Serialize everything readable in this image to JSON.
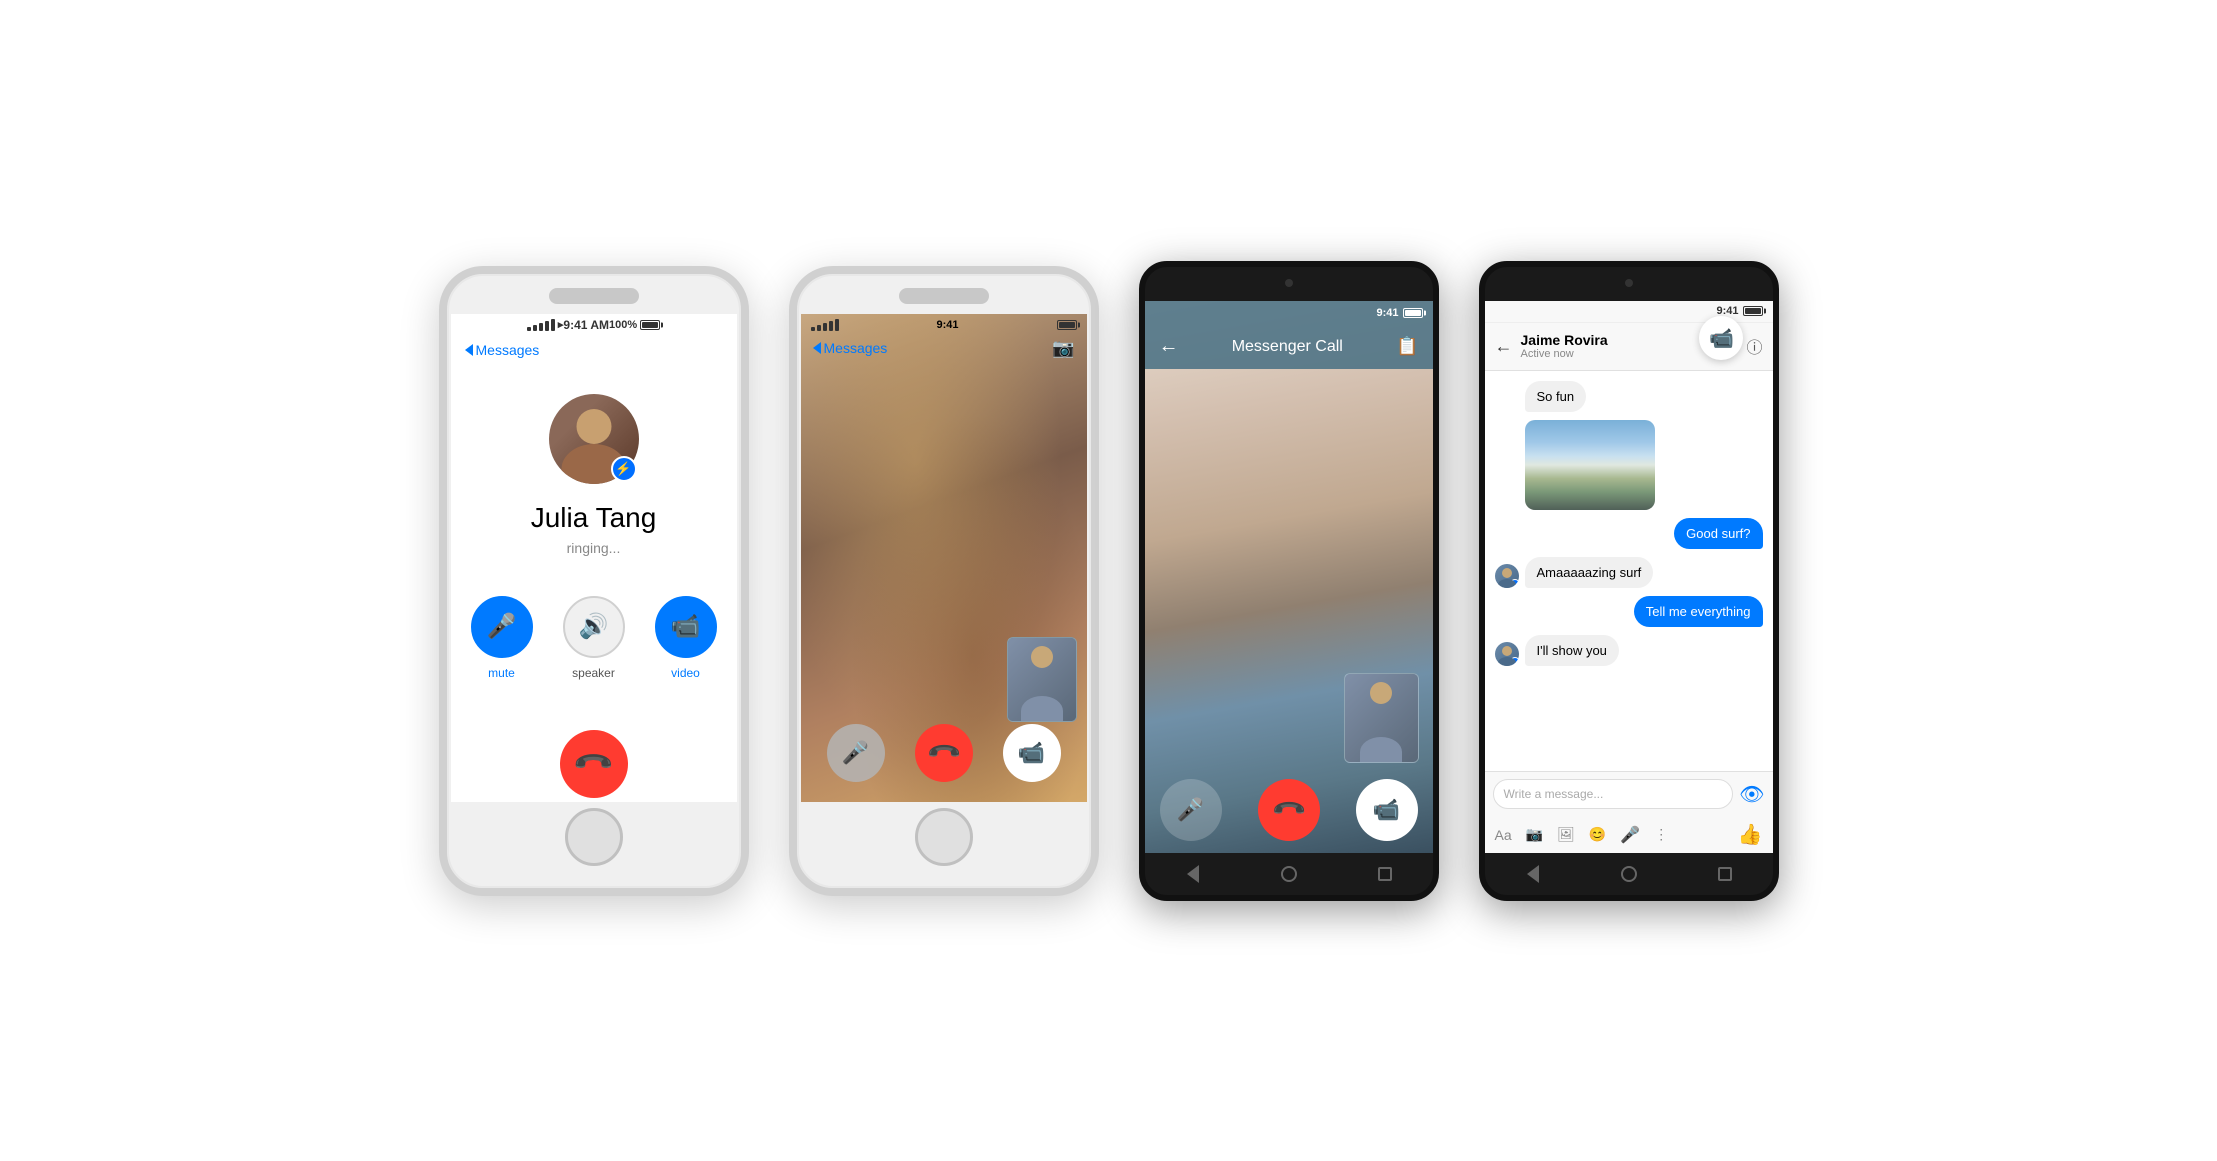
{
  "background": "#ffffff",
  "phones": [
    {
      "id": "phone1",
      "type": "iphone",
      "description": "iPhone calling screen",
      "status_bar": {
        "left": "●●●●● ▸",
        "center": "9:41 AM",
        "right": "100%"
      },
      "nav": {
        "back_label": "Messages"
      },
      "contact": {
        "name": "Julia Tang",
        "status": "ringing..."
      },
      "controls": [
        {
          "id": "mute",
          "label": "mute",
          "icon": "🎤",
          "style": "blue"
        },
        {
          "id": "speaker",
          "label": "speaker",
          "icon": "🔊",
          "style": "white"
        },
        {
          "id": "video",
          "label": "video",
          "icon": "📷",
          "style": "blue"
        }
      ],
      "end_call_icon": "📞"
    },
    {
      "id": "phone2",
      "type": "iphone",
      "description": "iPhone video call screen",
      "status_bar": {
        "left": "●●●●● ▸",
        "center": "9:41",
        "right": "100%"
      },
      "nav": {
        "back_label": "Messages"
      },
      "pip": true,
      "controls": [
        {
          "id": "mute",
          "icon": "🎤",
          "style": "mute"
        },
        {
          "id": "end",
          "icon": "📞",
          "style": "end"
        },
        {
          "id": "video",
          "icon": "📷",
          "style": "video"
        }
      ]
    },
    {
      "id": "phone3",
      "type": "android",
      "description": "Android video call screen",
      "status_bar": {
        "right": "9:41"
      },
      "header": {
        "title": "Messenger Call",
        "back_icon": "←",
        "right_icon": "📋"
      },
      "pip": true,
      "controls": [
        {
          "id": "mute",
          "icon": "🎤",
          "style": "mute"
        },
        {
          "id": "end",
          "icon": "📞",
          "style": "end"
        },
        {
          "id": "video",
          "icon": "📷",
          "style": "video"
        }
      ]
    },
    {
      "id": "phone4",
      "type": "android",
      "description": "Android chat screen",
      "status_bar": {
        "right": "9:41"
      },
      "header": {
        "contact_name": "Jaime Rovira",
        "contact_status": "Active now",
        "back_icon": "←",
        "video_icon": "📹",
        "info_icon": "ⓘ"
      },
      "messages": [
        {
          "id": "m1",
          "type": "recv",
          "text": "So fun",
          "has_avatar": false
        },
        {
          "id": "m2",
          "type": "recv",
          "text": "image",
          "has_image": true,
          "has_avatar": false
        },
        {
          "id": "m3",
          "type": "sent",
          "text": "Good surf?"
        },
        {
          "id": "m4",
          "type": "recv",
          "text": "Amaaaaazing surf",
          "has_avatar": true
        },
        {
          "id": "m5",
          "type": "sent",
          "text": "Tell me everything"
        },
        {
          "id": "m6",
          "type": "recv",
          "text": "I'll show you",
          "has_avatar": true
        }
      ],
      "input_placeholder": "Write a message...",
      "action_icons": [
        "Aa",
        "📷",
        "🖼",
        "😊",
        "🎤",
        "⋮"
      ]
    }
  ]
}
